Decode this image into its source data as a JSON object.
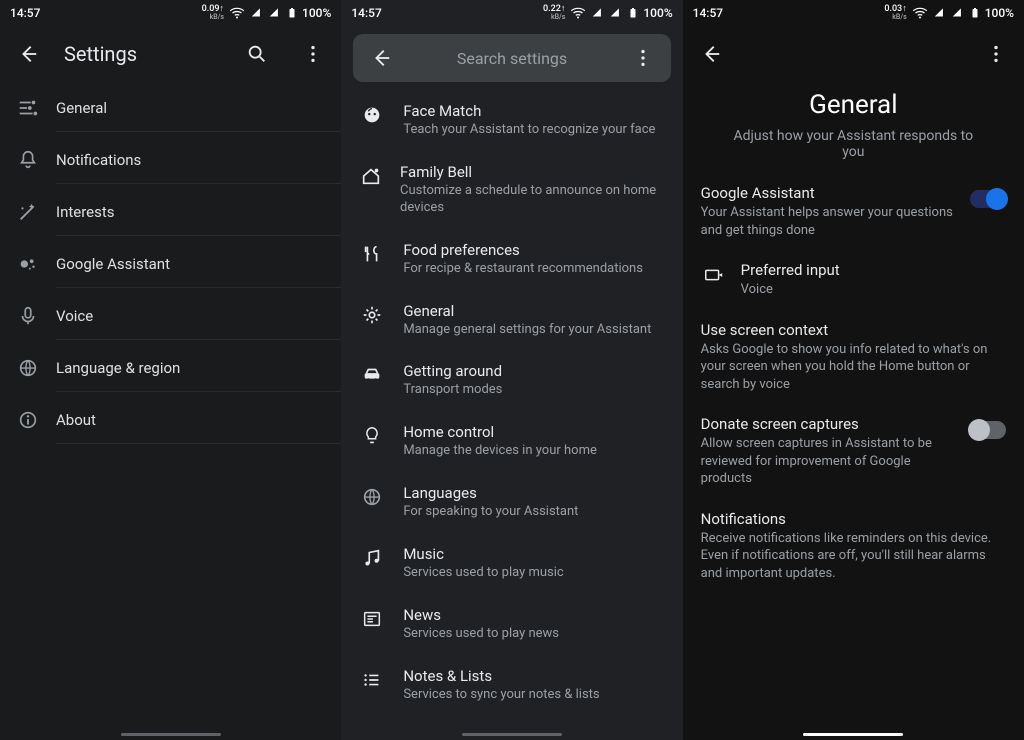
{
  "status": {
    "time": "14:57",
    "battery": "100%",
    "net1": "0.09",
    "net2": "0.22",
    "net3": "0.03",
    "netUnit": "kB/s"
  },
  "p1": {
    "title": "Settings",
    "items": [
      {
        "label": "General",
        "icon": "tune"
      },
      {
        "label": "Notifications",
        "icon": "bell"
      },
      {
        "label": "Interests",
        "icon": "wand"
      },
      {
        "label": "Google Assistant",
        "icon": "assistant"
      },
      {
        "label": "Voice",
        "icon": "mic"
      },
      {
        "label": "Language & region",
        "icon": "globe"
      },
      {
        "label": "About",
        "icon": "info"
      }
    ]
  },
  "p2": {
    "searchPlaceholder": "Search settings",
    "items": [
      {
        "title": "Face Match",
        "sub": "Teach your Assistant to recognize your face",
        "icon": "face"
      },
      {
        "title": "Family Bell",
        "sub": "Customize a schedule to announce on home devices",
        "icon": "homebell"
      },
      {
        "title": "Food preferences",
        "sub": "For recipe & restaurant recommendations",
        "icon": "food"
      },
      {
        "title": "General",
        "sub": "Manage general settings for your Assistant",
        "icon": "gear"
      },
      {
        "title": "Getting around",
        "sub": "Transport modes",
        "icon": "car"
      },
      {
        "title": "Home control",
        "sub": "Manage the devices in your home",
        "icon": "bulb"
      },
      {
        "title": "Languages",
        "sub": "For speaking to your Assistant",
        "icon": "globe"
      },
      {
        "title": "Music",
        "sub": "Services used to play music",
        "icon": "music"
      },
      {
        "title": "News",
        "sub": "Services used to play news",
        "icon": "news"
      },
      {
        "title": "Notes & Lists",
        "sub": "Services to sync your notes & lists",
        "icon": "list"
      }
    ]
  },
  "p3": {
    "title": "General",
    "subtitle": "Adjust how your Assistant responds to you",
    "rows": [
      {
        "title": "Google Assistant",
        "sub": "Your Assistant helps answer your questions and get things done",
        "toggle": "on"
      },
      {
        "title": "Preferred input",
        "sub": "Voice",
        "icon": "input"
      },
      {
        "title": "Use screen context",
        "sub": "Asks Google to show you info related to what's on your screen when you hold the Home button or search by voice"
      },
      {
        "title": "Donate screen captures",
        "sub": "Allow screen captures in Assistant to be reviewed for improvement of Google products",
        "toggle": "off"
      },
      {
        "title": "Notifications",
        "sub": "Receive notifications like reminders on this device. Even if notifications are off, you'll still hear alarms and important updates."
      }
    ]
  }
}
